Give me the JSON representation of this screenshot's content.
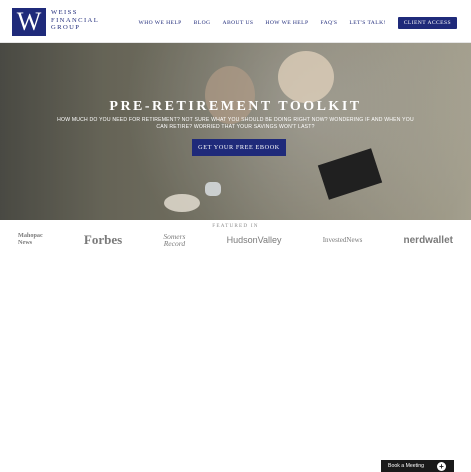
{
  "header": {
    "logo_letter": "W",
    "logo_lines": [
      "WEISS",
      "FINANCIAL",
      "GROUP"
    ],
    "nav": [
      "WHO WE HELP",
      "BLOG",
      "ABOUT US",
      "HOW WE HELP",
      "FAQ'S",
      "LET'S TALK!"
    ],
    "cta": "CLIENT ACCESS"
  },
  "hero": {
    "title": "PRE-RETIREMENT TOOLKIT",
    "subtitle": "HOW MUCH DO YOU NEED FOR RETIREMENT? NOT SURE WHAT YOU SHOULD BE DOING RIGHT NOW? WONDERING IF AND WHEN YOU CAN RETIRE? WORRIED THAT YOUR SAVINGS WON'T LAST?",
    "button": "GET YOUR FREE EBOOK"
  },
  "featured": {
    "label": "FEATURED IN",
    "logos": [
      {
        "name": "Mahopac News",
        "text_lines": [
          "Mahopac",
          "News"
        ]
      },
      {
        "name": "Forbes",
        "text": "Forbes"
      },
      {
        "name": "The Somers Record",
        "text_lines": [
          "Somers",
          "Record"
        ]
      },
      {
        "name": "Hudson Valley",
        "text": "HudsonValley"
      },
      {
        "name": "Invested News",
        "text": "InvestedNews"
      },
      {
        "name": "nerdwallet",
        "text": "nerdwallet"
      }
    ]
  },
  "widget": {
    "label": "Book a Meeting",
    "plus": "+"
  },
  "colors": {
    "brand_navy": "#1f2a7a",
    "widget_dark": "#1a1a1a"
  }
}
